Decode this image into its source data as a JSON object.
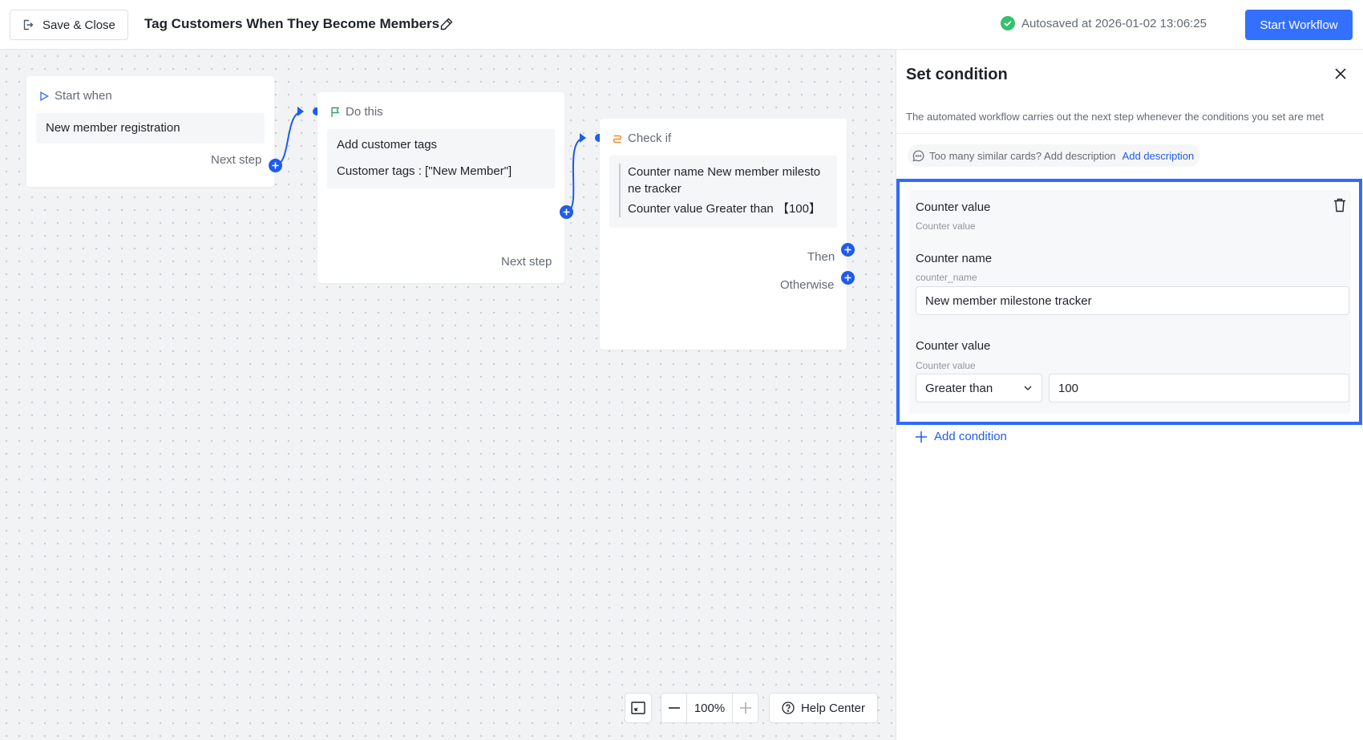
{
  "header": {
    "save_close_label": "Save & Close",
    "workflow_title": "Tag Customers When They Become Members",
    "autosave_text": "Autosaved at 2026-01-02 13:06:25",
    "start_button_label": "Start Workflow"
  },
  "canvas": {
    "start_node": {
      "heading": "Start when",
      "trigger": "New member registration",
      "next_label": "Next step"
    },
    "action_node": {
      "heading": "Do this",
      "action": "Add customer tags",
      "detail": "Customer tags : [\"New Member\"]",
      "next_label": "Next step"
    },
    "condition_node": {
      "heading": "Check if",
      "line1": "Counter name New member milesto",
      "line2": "ne tracker",
      "line3": "Counter value Greater than 【100】",
      "then_label": "Then",
      "otherwise_label": "Otherwise"
    },
    "controls": {
      "zoom_level": "100%",
      "help_label": "Help Center"
    }
  },
  "panel": {
    "title": "Set condition",
    "description": "The automated workflow carries out the next step whenever the conditions you set are met",
    "hint_text": "Too many similar cards? Add description",
    "hint_link": "Add description",
    "condition": {
      "title": "Counter value",
      "subtitle": "Counter value",
      "name_label": "Counter name",
      "name_key": "counter_name",
      "name_value": "New member milestone tracker",
      "value_label": "Counter value",
      "value_subtitle": "Counter value",
      "operator": "Greater than",
      "value": "100"
    },
    "add_condition_label": "Add condition"
  },
  "colors": {
    "accent": "#3370ff",
    "link_blue": "#1f5ce8",
    "success_green": "#34c16f",
    "flag_green": "#2ea26a",
    "condition_orange": "#f08a24",
    "highlight_frame": "#2f6bff"
  }
}
